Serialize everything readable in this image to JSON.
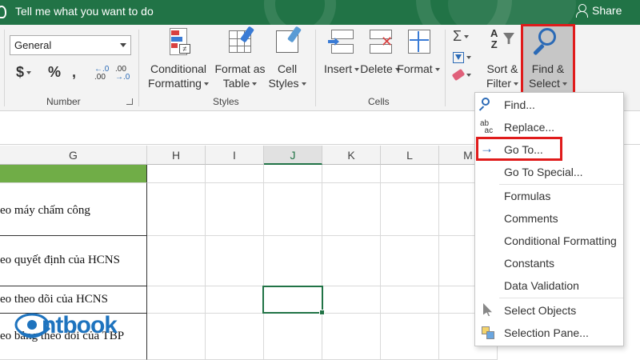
{
  "titlebar": {
    "tell_me": "Tell me what you want to do",
    "share": "Share"
  },
  "ribbon": {
    "number_format": "General",
    "number_buttons": [
      "$",
      "%",
      ","
    ],
    "decimal_increase": ".0\n.00",
    "decimal_decrease": ".00\n.0",
    "groups": {
      "number": "Number",
      "styles": "Styles",
      "cells": "Cells"
    },
    "styles": {
      "conditional_line1": "Conditional",
      "conditional_line2": "Formatting",
      "format_table_line1": "Format as",
      "format_table_line2": "Table",
      "cell_styles_line1": "Cell",
      "cell_styles_line2": "Styles"
    },
    "cells": {
      "insert": "Insert",
      "delete": "Delete",
      "format": "Format"
    },
    "editing": {
      "sum_symbol": "Σ",
      "sort_line1": "Sort &",
      "sort_line2": "Filter",
      "find_line1": "Find &",
      "find_line2": "Select"
    }
  },
  "grid": {
    "columns": [
      "G",
      "H",
      "I",
      "J",
      "K",
      "L",
      "M"
    ],
    "selected_column": "J",
    "rows": [
      "eo máy chấm công",
      "eo quyết định của HCNS",
      "eo theo dõi của HCNS",
      "eo bảng theo dõi của TBP"
    ],
    "header_fill_color": "#70ad47"
  },
  "find_menu": {
    "items": [
      {
        "label": "Find...",
        "icon": "magnifier-icon"
      },
      {
        "label": "Replace...",
        "icon": "replace-icon"
      },
      {
        "label": "Go To...",
        "icon": "arrow-right-icon"
      },
      {
        "label": "Go To Special...",
        "icon": ""
      },
      {
        "label": "Formulas",
        "icon": ""
      },
      {
        "label": "Comments",
        "icon": ""
      },
      {
        "label": "Conditional Formatting",
        "icon": ""
      },
      {
        "label": "Constants",
        "icon": ""
      },
      {
        "label": "Data Validation",
        "icon": ""
      },
      {
        "label": "Select Objects",
        "icon": "cursor-icon"
      },
      {
        "label": "Selection Pane...",
        "icon": "selection-pane-icon"
      }
    ]
  },
  "logo": {
    "text": "ntbook"
  },
  "colors": {
    "title_bar": "#217346",
    "highlight": "#e01b1b",
    "accent_blue": "#2b6ab6"
  }
}
